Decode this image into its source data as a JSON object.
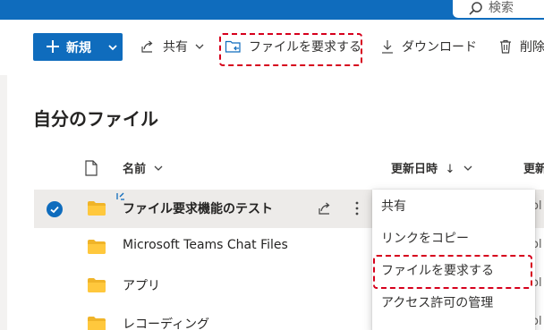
{
  "suitebar": {
    "search_placeholder": "検索",
    "color": "#0f6cbd"
  },
  "toolbar": {
    "new_label": "新規",
    "share_label": "共有",
    "request_files_label": "ファイルを要求する",
    "download_label": "ダウンロード",
    "delete_label": "削除"
  },
  "page": {
    "title": "自分のファイル"
  },
  "columns": {
    "name": "名前",
    "modified": "更新日時",
    "modified_sort": "↓",
    "next": "更新"
  },
  "files": [
    {
      "name": "ファイル要求機能のテスト",
      "selected": true,
      "tail": "ol"
    },
    {
      "name": "Microsoft Teams Chat Files",
      "selected": false,
      "tail": "ol"
    },
    {
      "name": "アプリ",
      "selected": false,
      "tail": "ol"
    },
    {
      "name": "レコーディング",
      "selected": false,
      "tail": "ol"
    }
  ],
  "context_menu": {
    "items": [
      "共有",
      "リンクをコピー",
      "ファイルを要求する",
      "アクセス許可の管理"
    ],
    "highlighted_index": 2
  },
  "highlight_color": "#d6001c",
  "icons": [
    "search-icon",
    "plus-icon",
    "chevron-down-icon",
    "share-icon",
    "request-files-icon",
    "download-icon",
    "trash-icon",
    "document-icon",
    "folder-icon",
    "checkmark-icon",
    "more-vertical-icon"
  ]
}
